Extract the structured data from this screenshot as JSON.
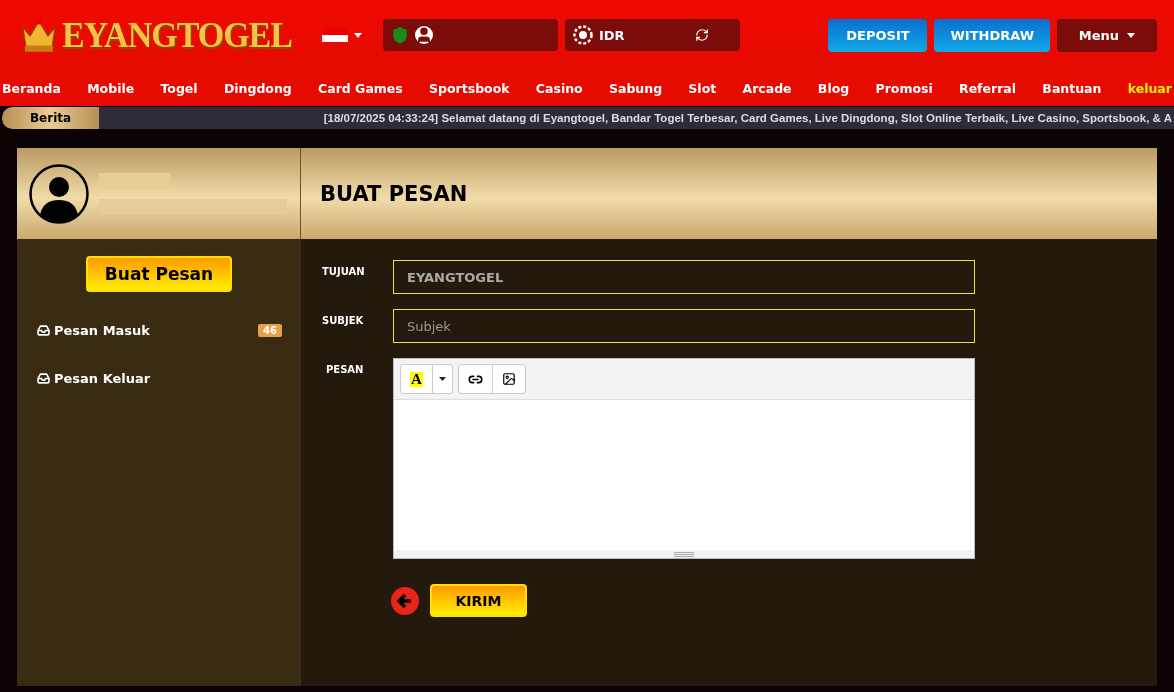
{
  "header": {
    "logo": "EYANGTOGEL",
    "currency": "IDR",
    "buttons": [
      {
        "label": "DEPOSIT",
        "kind": "blue"
      },
      {
        "label": "WITHDRAW",
        "kind": "blue"
      },
      {
        "label": "Menu",
        "kind": "menu"
      }
    ]
  },
  "nav": [
    {
      "label": "Beranda",
      "kind": "link"
    },
    {
      "label": "Mobile",
      "kind": "link"
    },
    {
      "label": "Togel",
      "kind": "link"
    },
    {
      "label": "Dingdong",
      "kind": "link"
    },
    {
      "label": "Card Games",
      "kind": "link"
    },
    {
      "label": "Sportsbook",
      "kind": "link"
    },
    {
      "label": "Casino",
      "kind": "link"
    },
    {
      "label": "Sabung",
      "kind": "link"
    },
    {
      "label": "Slot",
      "kind": "link"
    },
    {
      "label": "Arcade",
      "kind": "link"
    },
    {
      "label": "Blog",
      "kind": "link"
    },
    {
      "label": "Promosi",
      "kind": "link"
    },
    {
      "label": "Referral",
      "kind": "link"
    },
    {
      "label": "Bantuan",
      "kind": "link"
    },
    {
      "label": "keluar",
      "kind": "logout"
    }
  ],
  "ticker": {
    "label": "Berita",
    "text": "[18/07/2025 04:33:24] Selamat datang di Eyangtogel, Bandar Togel Terbesar, Card Games, Live Dingdong, Slot Online Terbaik, Live Casino, Sportsbook, & A"
  },
  "sidebar": {
    "compose_button": "Buat Pesan",
    "items": [
      {
        "label": "Pesan Masuk",
        "badge": "46"
      },
      {
        "label": "Pesan Keluar"
      }
    ]
  },
  "main": {
    "title": "BUAT PESAN",
    "fields": [
      {
        "label": "TUJUAN",
        "value": "EYANGTOGEL"
      },
      {
        "label": "SUBJEK",
        "placeholder": "Subjek"
      }
    ],
    "message_label": "PESAN",
    "editor": {
      "font_color_button": "A"
    },
    "send_button": "KIRIM"
  }
}
